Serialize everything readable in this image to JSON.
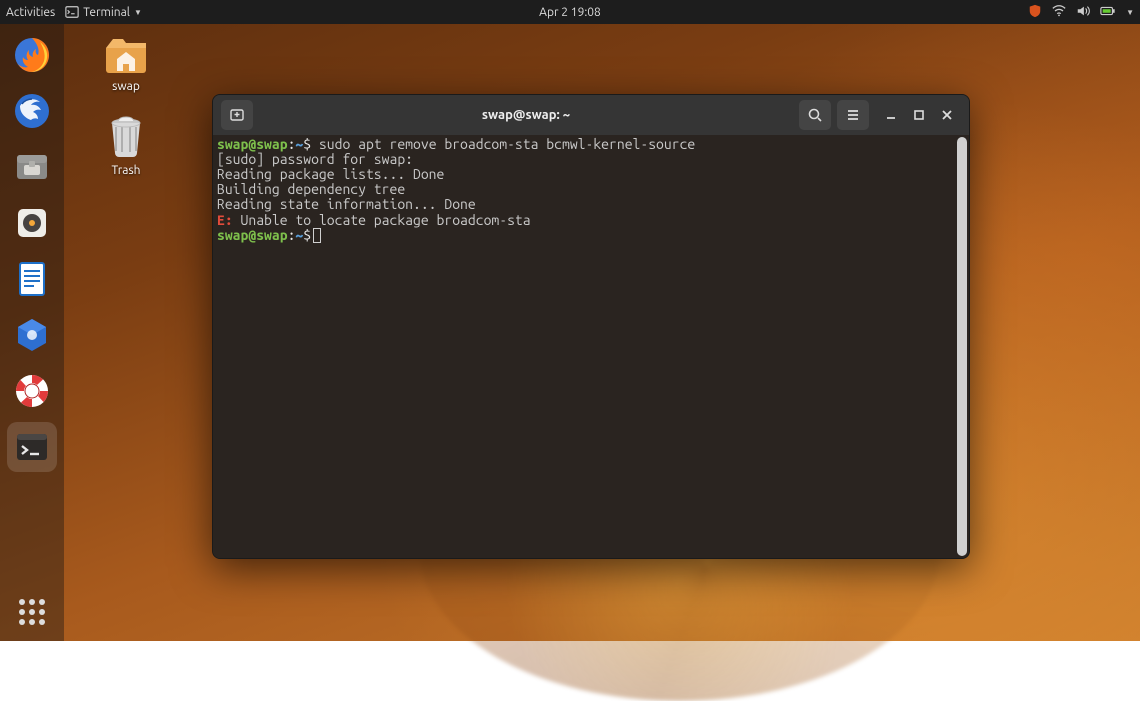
{
  "topbar": {
    "activities": "Activities",
    "app_name": "Terminal",
    "datetime": "Apr 2  19:08"
  },
  "desktop_icons": {
    "home_label": "swap",
    "trash_label": "Trash"
  },
  "dock": {
    "items": [
      {
        "name": "firefox"
      },
      {
        "name": "thunderbird"
      },
      {
        "name": "files"
      },
      {
        "name": "rhythmbox"
      },
      {
        "name": "writer"
      },
      {
        "name": "software"
      },
      {
        "name": "help"
      },
      {
        "name": "terminal"
      }
    ]
  },
  "terminal": {
    "title": "swap@swap: ~",
    "prompt": {
      "userhost": "swap@swap",
      "colon": ":",
      "path": "~",
      "dollar": "$"
    },
    "lines": {
      "cmd1": " sudo apt remove broadcom-sta bcmwl-kernel-source",
      "l2": "[sudo] password for swap:",
      "l3": "Reading package lists... Done",
      "l4": "Building dependency tree",
      "l5": "Reading state information... Done",
      "err_prefix": "E:",
      "err_msg": " Unable to locate package broadcom-sta"
    }
  }
}
